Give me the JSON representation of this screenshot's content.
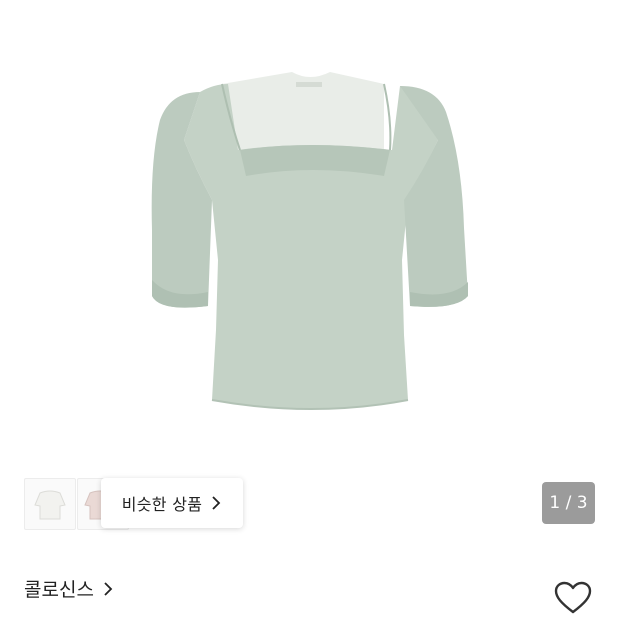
{
  "product": {
    "image": {
      "icon": "green-puff-sleeve-square-neck-top",
      "color": "#c4d2c6"
    },
    "thumbnails": [
      {
        "icon": "white-top-thumbnail"
      },
      {
        "icon": "pink-top-thumbnail"
      }
    ],
    "similar_button": {
      "label": "비슷한 상품",
      "icon": "chevron-right-icon"
    },
    "image_counter": "1 / 3",
    "brand": {
      "name": "콜로신스",
      "icon": "chevron-right-icon"
    },
    "wishlist": {
      "icon": "heart-outline-icon"
    }
  }
}
